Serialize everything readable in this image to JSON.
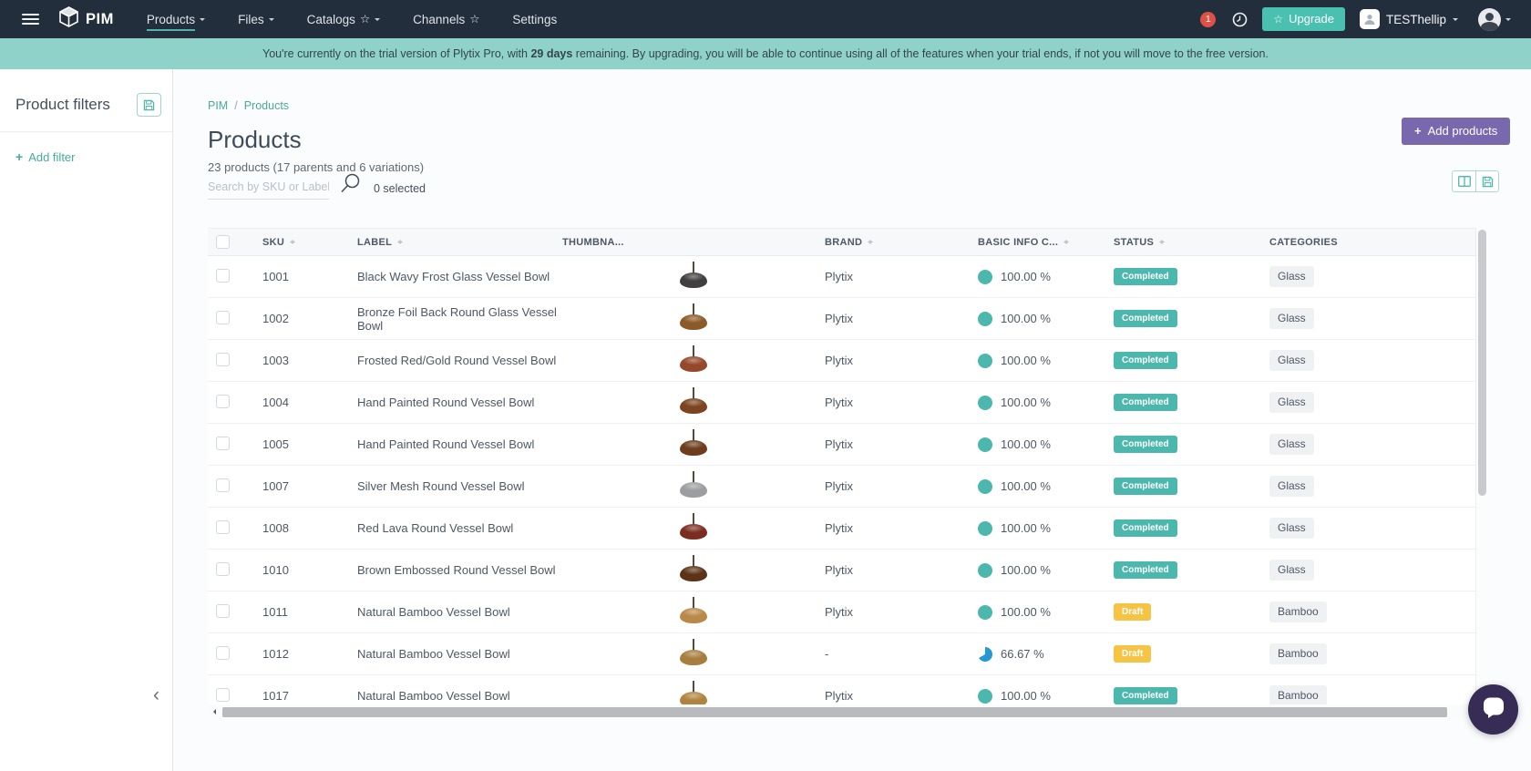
{
  "top_nav": {
    "brand": "PIM",
    "items": [
      {
        "label": "Products",
        "caret": true,
        "star": false,
        "active": true
      },
      {
        "label": "Files",
        "caret": true,
        "star": false,
        "active": false
      },
      {
        "label": "Catalogs",
        "caret": true,
        "star": true,
        "active": false
      },
      {
        "label": "Channels",
        "caret": false,
        "star": true,
        "active": false
      },
      {
        "label": "Settings",
        "caret": false,
        "star": false,
        "active": false
      }
    ],
    "notification_badge": "1",
    "upgrade_label": "Upgrade",
    "account_label": "TESThellip"
  },
  "trial_banner": {
    "prefix": "You're currently on the trial version of Plytix Pro, with ",
    "bold": "29 days",
    "suffix": " remaining. By upgrading, you will be able to continue using all of the features when your trial ends, if not you will move to the free version."
  },
  "sidebar": {
    "title": "Product filters",
    "add_filter_label": "Add filter"
  },
  "breadcrumb": {
    "items": [
      "PIM",
      "Products"
    ],
    "separator": "/"
  },
  "page": {
    "title": "Products",
    "subtitle": "23 products (17 parents and 6 variations)",
    "add_products_label": "Add products",
    "search_placeholder": "Search by SKU or Label",
    "selected_label": "0 selected"
  },
  "icons": {
    "plus": "+",
    "star": "☆",
    "collapse": "‹"
  },
  "table": {
    "columns": [
      {
        "key": "sku",
        "label": "SKU",
        "sortable": true
      },
      {
        "key": "label",
        "label": "LABEL",
        "sortable": true
      },
      {
        "key": "thumbnail",
        "label": "THUMBNA...",
        "sortable": false
      },
      {
        "key": "brand",
        "label": "BRAND",
        "sortable": true
      },
      {
        "key": "basic",
        "label": "BASIC INFO C...",
        "sortable": true
      },
      {
        "key": "status",
        "label": "STATUS",
        "sortable": true
      },
      {
        "key": "categories",
        "label": "CATEGORIES",
        "sortable": false
      }
    ],
    "rows": [
      {
        "sku": "1001",
        "label": "Black Wavy Frost Glass Vessel Bowl",
        "brand": "Plytix",
        "completeness": "100.00 %",
        "pct": 100,
        "status": "Completed",
        "category": "Glass",
        "thumb_color": "#413e3f"
      },
      {
        "sku": "1002",
        "label": "Bronze Foil Back Round Glass Vessel Bowl",
        "brand": "Plytix",
        "completeness": "100.00 %",
        "pct": 100,
        "status": "Completed",
        "category": "Glass",
        "thumb_color": "#8a5a28"
      },
      {
        "sku": "1003",
        "label": "Frosted Red/Gold Round Vessel Bowl",
        "brand": "Plytix",
        "completeness": "100.00 %",
        "pct": 100,
        "status": "Completed",
        "category": "Glass",
        "thumb_color": "#95482a"
      },
      {
        "sku": "1004",
        "label": "Hand Painted Round Vessel Bowl",
        "brand": "Plytix",
        "completeness": "100.00 %",
        "pct": 100,
        "status": "Completed",
        "category": "Glass",
        "thumb_color": "#7c4420"
      },
      {
        "sku": "1005",
        "label": "Hand Painted Round Vessel Bowl",
        "brand": "Plytix",
        "completeness": "100.00 %",
        "pct": 100,
        "status": "Completed",
        "category": "Glass",
        "thumb_color": "#6e3d1e"
      },
      {
        "sku": "1007",
        "label": "Silver Mesh Round Vessel Bowl",
        "brand": "Plytix",
        "completeness": "100.00 %",
        "pct": 100,
        "status": "Completed",
        "category": "Glass",
        "thumb_color": "#9c9da0"
      },
      {
        "sku": "1008",
        "label": "Red Lava Round Vessel Bowl",
        "brand": "Plytix",
        "completeness": "100.00 %",
        "pct": 100,
        "status": "Completed",
        "category": "Glass",
        "thumb_color": "#7c2d21"
      },
      {
        "sku": "1010",
        "label": "Brown Embossed Round Vessel Bowl",
        "brand": "Plytix",
        "completeness": "100.00 %",
        "pct": 100,
        "status": "Completed",
        "category": "Glass",
        "thumb_color": "#5d3317"
      },
      {
        "sku": "1011",
        "label": "Natural Bamboo Vessel Bowl",
        "brand": "Plytix",
        "completeness": "100.00 %",
        "pct": 100,
        "status": "Draft",
        "category": "Bamboo",
        "thumb_color": "#b9894a"
      },
      {
        "sku": "1012",
        "label": "Natural Bamboo Vessel Bowl",
        "brand": "-",
        "completeness": "66.67 %",
        "pct": 66.67,
        "status": "Draft",
        "category": "Bamboo",
        "thumb_color": "#a87e3f"
      },
      {
        "sku": "1017",
        "label": "Natural Bamboo Vessel Bowl",
        "brand": "Plytix",
        "completeness": "100.00 %",
        "pct": 100,
        "status": "Completed",
        "category": "Bamboo",
        "thumb_color": "#b08440"
      }
    ]
  },
  "colors": {
    "nav_bg": "#232e3c",
    "banner_bg": "#8fd2ca",
    "accent_teal": "#49a9a1",
    "upgrade_teal": "#49c0b0",
    "purple": "#7a68ae",
    "notification_red": "#dd5147",
    "status_completed": "#4cb8ad",
    "status_draft": "#f6c445",
    "completeness_full": "#4cb8ad",
    "completeness_partial": "#2698d4",
    "chat_bg": "#372c56"
  }
}
